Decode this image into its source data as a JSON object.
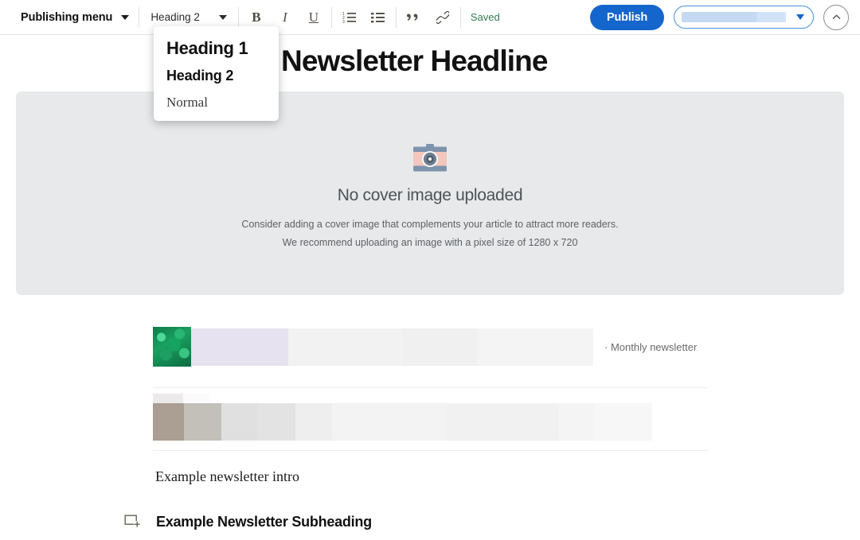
{
  "toolbar": {
    "publishing_menu_label": "Publishing menu",
    "publishing_menu_caret": "chevron-down-icon",
    "style_select_value": "Heading 2",
    "bold_label": "B",
    "italic_label": "I",
    "underline_label": "U",
    "ordered_list_icon": "ordered-list-icon",
    "bullet_list_icon": "bullet-list-icon",
    "quote_icon": "quote-icon",
    "link_icon": "link-icon",
    "save_status": "Saved",
    "publish_label": "Publish",
    "publication_select_value": "",
    "publication_select_state": "loading",
    "collapse_icon": "chevron-up-icon",
    "accent_blue": "#1566cc",
    "saved_green": "#2f7d4f"
  },
  "style_menu": {
    "open": true,
    "items": [
      {
        "label": "Heading 1"
      },
      {
        "label": "Heading 2"
      },
      {
        "label": "Normal"
      }
    ]
  },
  "editor": {
    "headline": "Newsletter Headline",
    "cover": {
      "icon": "camera-icon",
      "title": "No cover image uploaded",
      "line1": "Consider adding a cover image that complements your article to attract more readers.",
      "line2": "We recommend uploading an image with a pixel size of 1280 x 720",
      "background": "#e8e9ea"
    },
    "blocks": [
      {
        "type": "embed",
        "thumbnail": "green-foliage-thumbnail",
        "caption": "· Monthly newsletter"
      },
      {
        "type": "embed-skeleton",
        "caption": ""
      },
      {
        "type": "paragraph",
        "text": "Example newsletter intro"
      },
      {
        "type": "heading",
        "text": "Example Newsletter Subheading",
        "gutter_icon": "add-block-icon"
      }
    ]
  }
}
